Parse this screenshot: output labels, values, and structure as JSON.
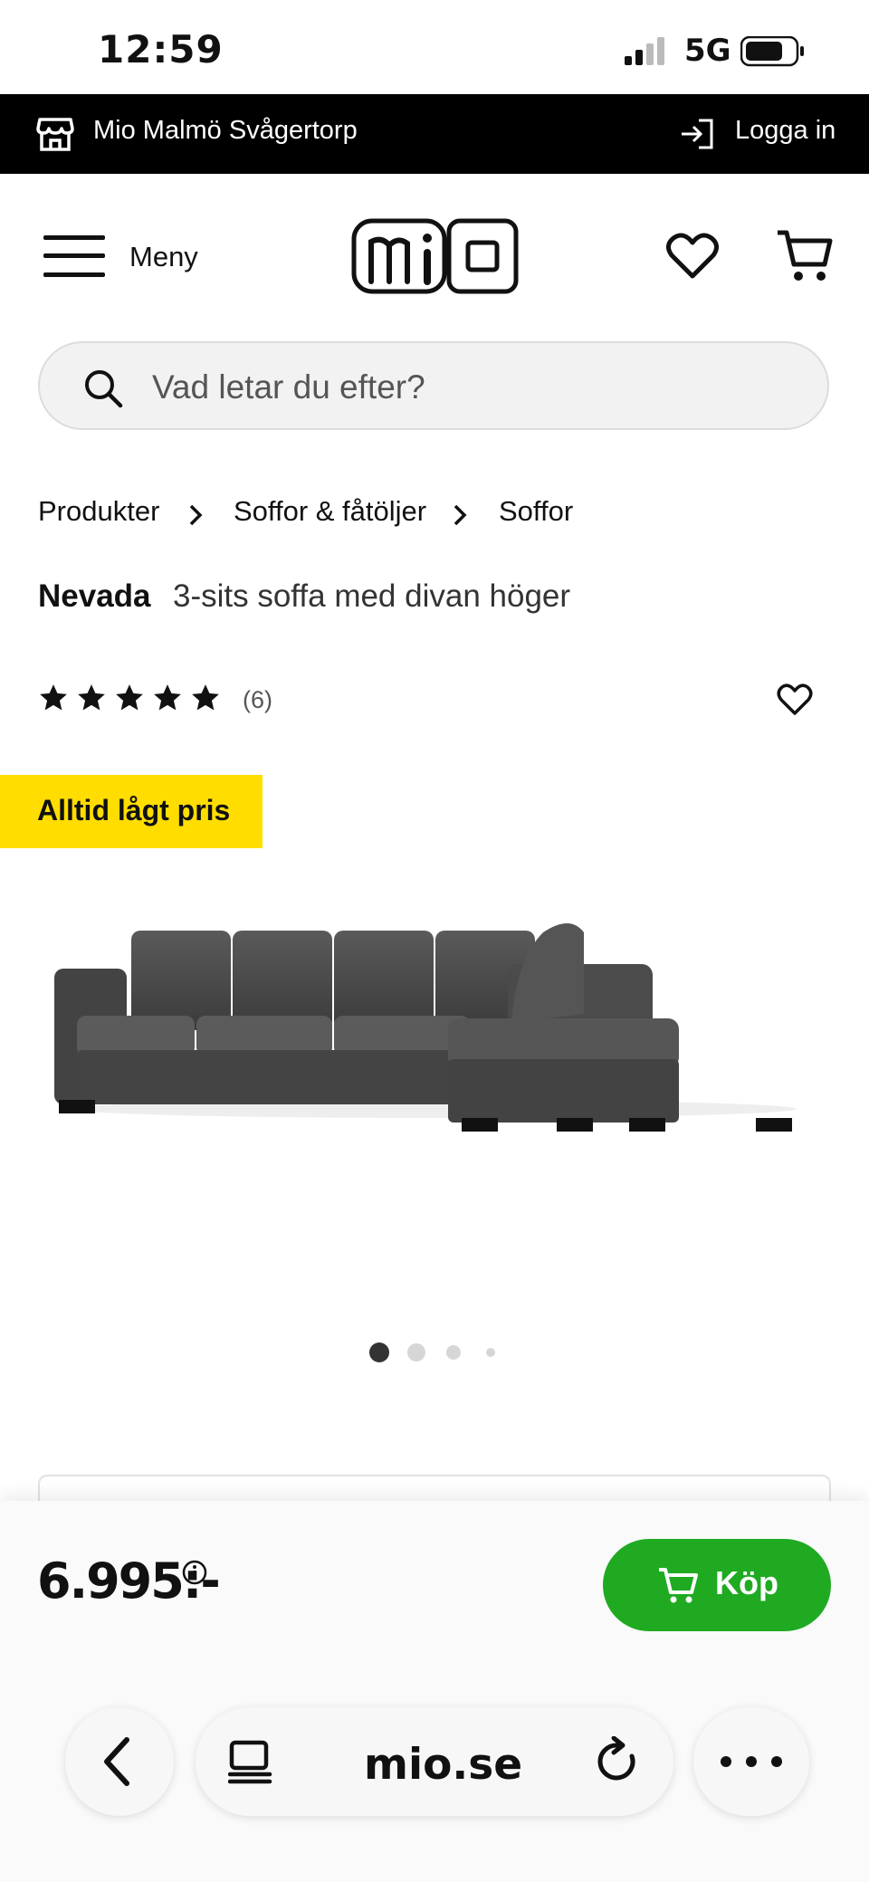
{
  "status_bar": {
    "time": "12:59",
    "network": "5G"
  },
  "store_bar": {
    "store_name": "Mio Malmö Svågertorp",
    "login_label": "Logga in"
  },
  "header": {
    "menu_label": "Meny",
    "logo_text": "mio"
  },
  "search": {
    "placeholder": "Vad letar du efter?"
  },
  "breadcrumb": [
    "Produkter",
    "Soffor & fåtöljer",
    "Soffor"
  ],
  "product": {
    "brand": "Nevada",
    "description": "3-sits soffa med divan höger",
    "rating_stars": 5,
    "rating_count": "(6)",
    "badge": "Alltid lågt pris",
    "image_count": 4,
    "active_image": 1
  },
  "purchase": {
    "price": "6.995:-",
    "buy_label": "Köp"
  },
  "browser": {
    "url": "mio.se"
  },
  "colors": {
    "badge": "#ffdd00",
    "buy_button": "#1faa22",
    "store_bar": "#000000"
  },
  "icons": [
    "store-icon",
    "login-icon",
    "menu-icon",
    "heart-icon",
    "cart-icon",
    "search-icon",
    "chevron-right-icon",
    "star-icon",
    "info-icon",
    "back-icon",
    "tabs-icon",
    "reload-icon",
    "more-icon"
  ]
}
